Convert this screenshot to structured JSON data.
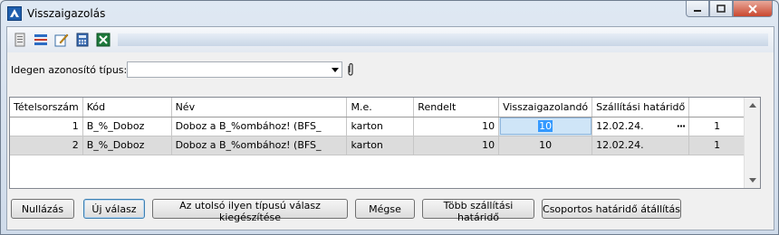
{
  "window": {
    "title": "Visszaigazolás"
  },
  "toolbar": {
    "icons": [
      "document-icon",
      "list-icon",
      "edit-icon",
      "calculator-icon",
      "excel-icon"
    ]
  },
  "filter": {
    "label": "Idegen azonosító típus:",
    "value": ""
  },
  "table": {
    "headers": [
      "Tételsorszám",
      "Kód",
      "Név",
      "M.e.",
      "Rendelt",
      "Visszaigazolandó",
      "Szállítási határidő",
      "",
      ""
    ],
    "rows": [
      {
        "tetel": "1",
        "kod": "B_%_Doboz",
        "nev": "Doboz a B_%ombához! (BFS_",
        "me": "karton",
        "rendelt": "10",
        "visszaigazolando": "10",
        "hatarido": "12.02.24.",
        "dots": "···",
        "extra": "1"
      },
      {
        "tetel": "2",
        "kod": "B_%_Doboz",
        "nev": "Doboz a B_%ombához! (BFS_",
        "me": "karton",
        "rendelt": "10",
        "visszaigazolando": "10",
        "hatarido": "12.02.24.",
        "dots": "",
        "extra": "1"
      }
    ]
  },
  "buttons": {
    "reset": "Nullázás",
    "new_reply": "Új válasz",
    "complete_last": "Az utolsó ilyen típusú válasz kiegészítése",
    "cancel": "Mégse",
    "more_deadlines": "Több szállítási határidő",
    "group_deadline": "Csoportos határidő átállítás"
  },
  "colors": {
    "selection": "#3399ff",
    "title_gradient_top": "#dfe8f3",
    "close_button": "#c9472f"
  }
}
